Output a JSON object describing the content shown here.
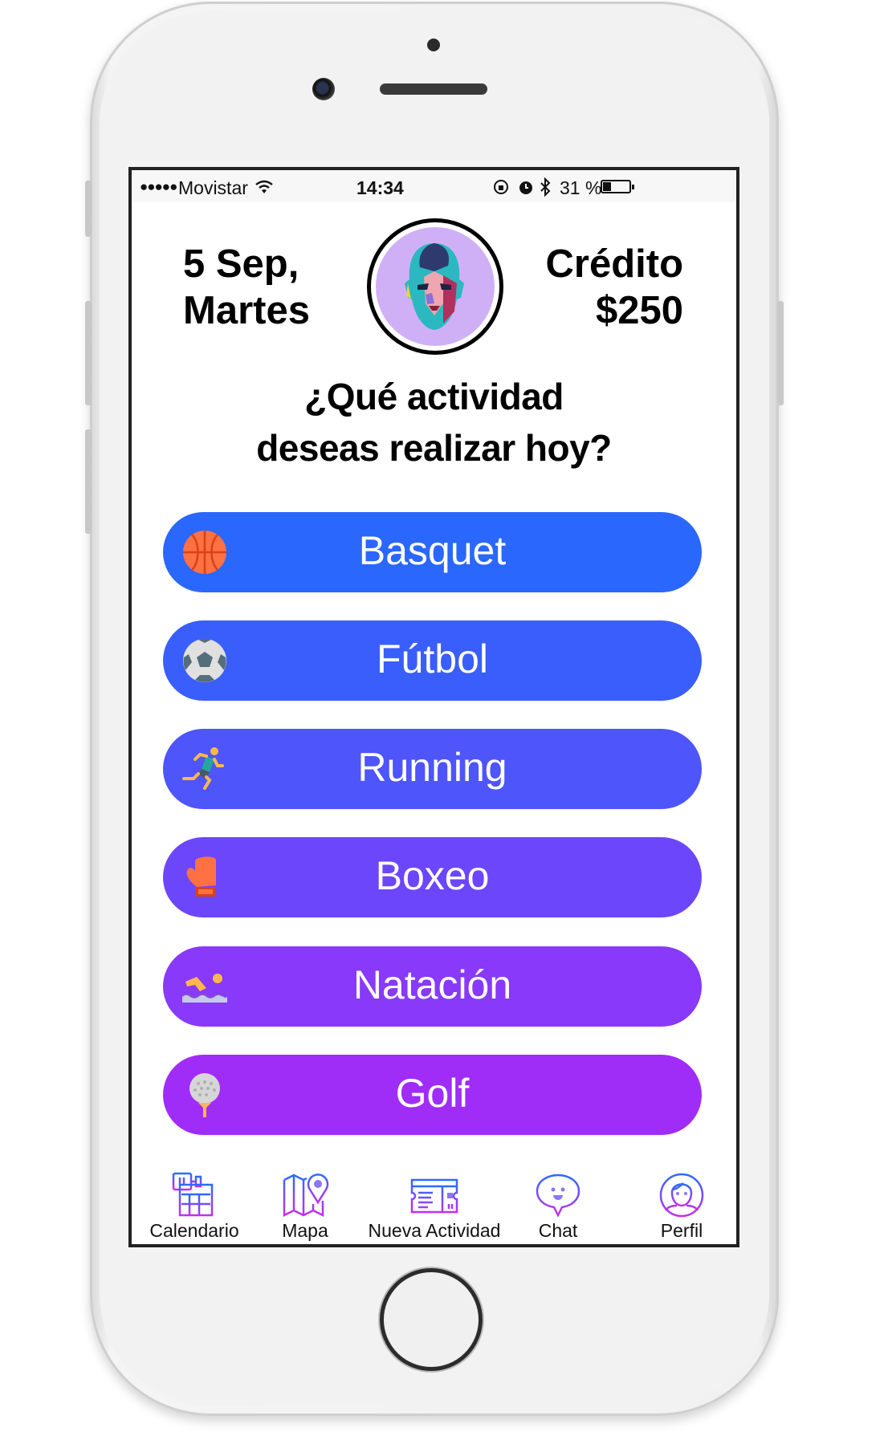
{
  "status_bar": {
    "carrier": "Movistar",
    "signal_dots": "●●●●●",
    "time": "14:34",
    "battery": "31 %",
    "battery_fraction": 0.31
  },
  "header": {
    "date_line1": "5 Sep,",
    "date_line2": "Martes",
    "credit_label": "Crédito",
    "credit_amount": "$250"
  },
  "question": {
    "line1": "¿Qué actividad",
    "line2": "deseas realizar hoy?"
  },
  "activities": [
    {
      "label": "Basquet",
      "icon": "basketball-icon",
      "color": "#2a67fd"
    },
    {
      "label": "Fútbol",
      "icon": "soccer-ball-icon",
      "color": "#3a5efb"
    },
    {
      "label": "Running",
      "icon": "runner-icon",
      "color": "#4d55fb"
    },
    {
      "label": "Boxeo",
      "icon": "boxing-glove-icon",
      "color": "#6c46fb"
    },
    {
      "label": "Natación",
      "icon": "swimmer-icon",
      "color": "#8839f9"
    },
    {
      "label": "Golf",
      "icon": "golf-ball-icon",
      "color": "#a02df7"
    }
  ],
  "nav": [
    {
      "label": "Calendario",
      "icon": "calendar-icon"
    },
    {
      "label": "Mapa",
      "icon": "map-icon"
    },
    {
      "label": "Nueva Actividad",
      "icon": "ticket-icon"
    },
    {
      "label": "Chat",
      "icon": "chat-bubble-icon"
    },
    {
      "label": "Perfil",
      "icon": "profile-icon"
    }
  ],
  "colors": {
    "icon_gradient_start": "#2b6cff",
    "icon_gradient_end": "#c52ef0"
  }
}
